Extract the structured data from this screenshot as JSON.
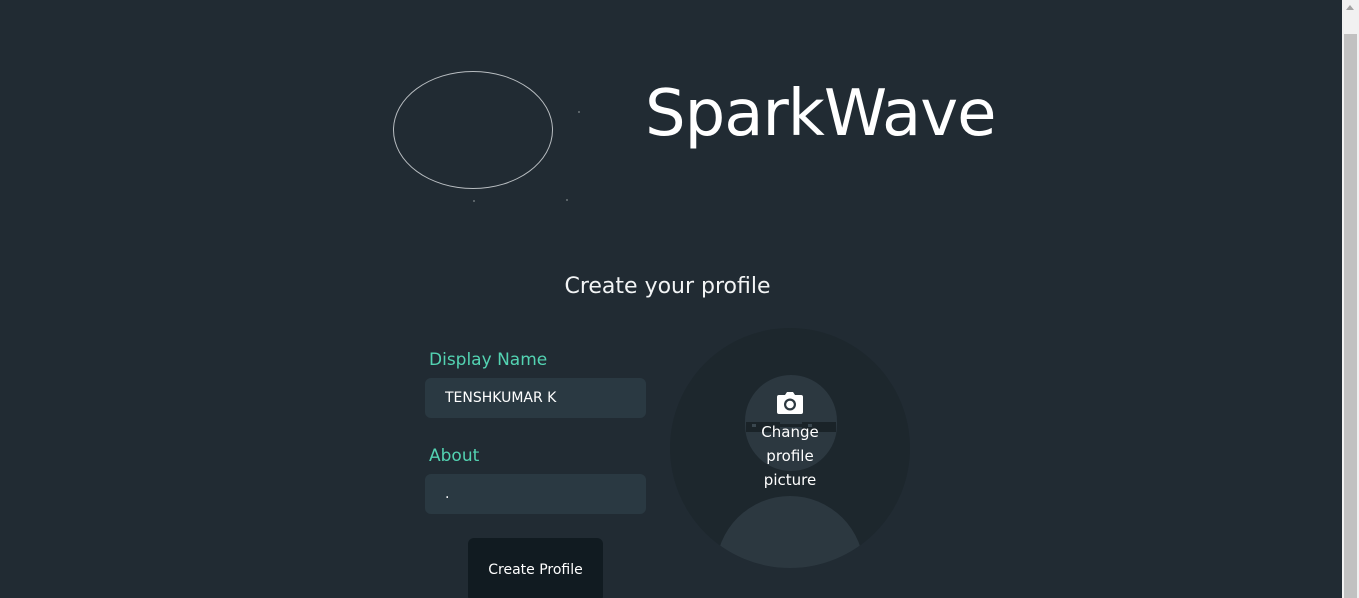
{
  "app": {
    "brand_name": "SparkWave"
  },
  "page": {
    "title": "Create your profile"
  },
  "form": {
    "display_name": {
      "label": "Display Name",
      "value": "TENSHKUMAR K"
    },
    "about": {
      "label": "About",
      "value": "."
    },
    "submit_label": "Create Profile"
  },
  "avatar": {
    "change_label": "Change profile picture",
    "icon": "camera-icon"
  },
  "colors": {
    "background": "#212b33",
    "input_background": "#2a3942",
    "label_accent": "#53d3b2",
    "button_background": "#111b21",
    "avatar_background": "#1d272d"
  }
}
